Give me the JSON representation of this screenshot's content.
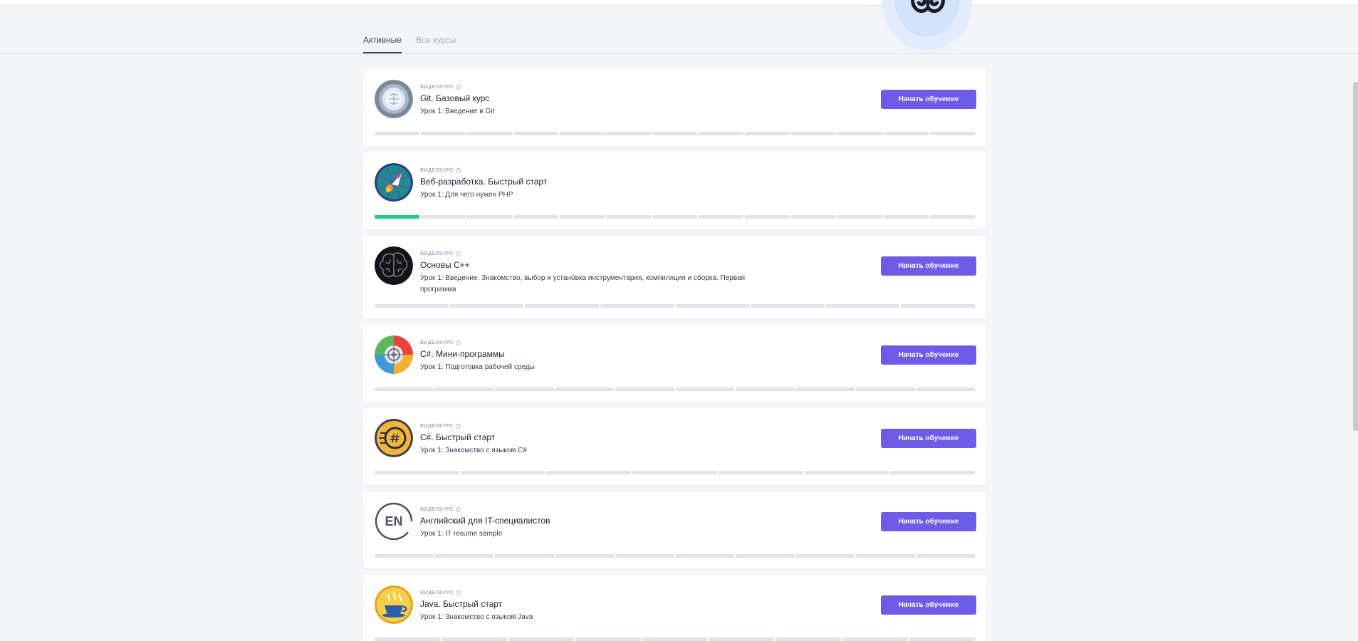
{
  "tabs": [
    {
      "label": "Активные",
      "active": true
    },
    {
      "label": "Все курсы",
      "active": false
    }
  ],
  "colors": {
    "accent": "#6c5ce7",
    "progress_done": "#22c98a",
    "progress_todo": "#e1e3e9",
    "background": "#f4f5f9"
  },
  "courses": [
    {
      "kind": "ВИДЕОКУРС",
      "title": "Git. Базовый курс",
      "lesson": "Урок 1: Введение в Git",
      "button": "Начать обучение",
      "icon": "git-course-icon",
      "progress": {
        "segments": 13,
        "completed": 0
      }
    },
    {
      "kind": "ВИДЕОКУРС",
      "title": "Веб-разработка. Быстрый старт",
      "lesson": "Урок 1: Для чего нужен PHP",
      "button": "",
      "icon": "rocket-icon",
      "progress": {
        "segments": 13,
        "completed": 1
      }
    },
    {
      "kind": "ВИДЕОКУРС",
      "title": "Основы C++",
      "lesson": "Урок 1: Введение. Знакомство, выбор и установка инструментария, компиляция и сборка. Первая программа",
      "button": "Начать обучение",
      "icon": "brain-icon",
      "progress": {
        "segments": 8,
        "completed": 0
      }
    },
    {
      "kind": "ВИДЕОКУРС",
      "title": "C#. Мини-программы",
      "lesson": "Урок 1: Подготовка рабочей среды",
      "button": "Начать обучение",
      "icon": "target-icon",
      "progress": {
        "segments": 10,
        "completed": 0
      }
    },
    {
      "kind": "ВИДЕОКУРС",
      "title": "C#. Быстрый старт",
      "lesson": "Урок 1: Знакомство с языком C#",
      "button": "Начать обучение",
      "icon": "csharp-coin-icon",
      "progress": {
        "segments": 7,
        "completed": 0
      }
    },
    {
      "kind": "ВИДЕОКУРС",
      "title": "Английский для IT-специалистов",
      "lesson": "Урок 1: IT resume sample",
      "button": "Начать обучение",
      "icon": "en-badge-icon",
      "icon_text": "EN",
      "progress": {
        "segments": 10,
        "completed": 0
      }
    },
    {
      "kind": "ВИДЕОКУРС",
      "title": "Java. Быстрый старт",
      "lesson": "Урок 1: Знакомство с языком Java",
      "button": "Начать обучение",
      "icon": "coffee-cup-icon",
      "progress": {
        "segments": 9,
        "completed": 0
      }
    }
  ]
}
